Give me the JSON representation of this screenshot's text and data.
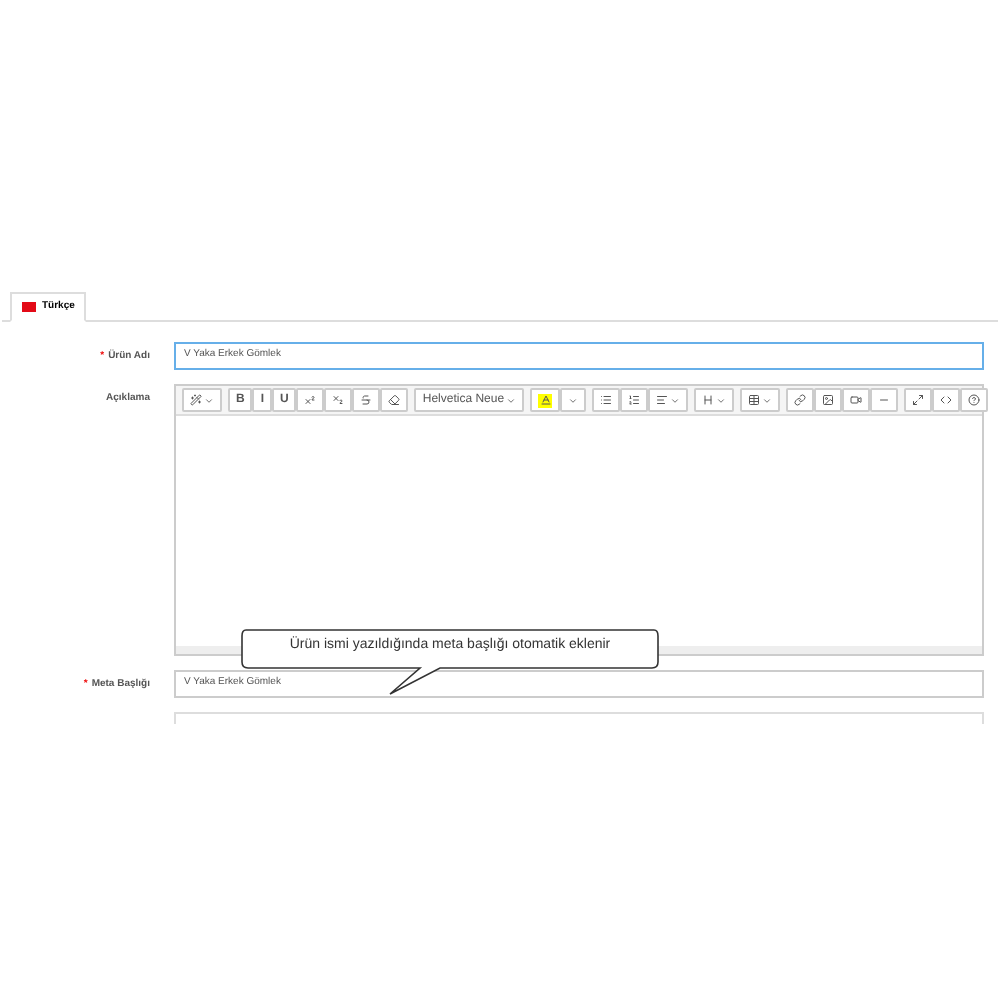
{
  "tabs": [
    {
      "label": "Türkçe",
      "selected": true
    }
  ],
  "fields": [
    {
      "kind": "input",
      "label": "Ürün Adı",
      "marker": "*",
      "value": "V Yaka Erkek Gömlek",
      "focused": true
    },
    {
      "kind": "editor",
      "label": "Açıklama",
      "font": "Helvetica Neue"
    },
    {
      "kind": "input",
      "label": "Meta Başlığı",
      "marker": "*",
      "value": "V Yaka Erkek Gömlek",
      "focused": false
    }
  ],
  "toolbar": [
    [
      {
        "kind": "style",
        "caret": true
      }
    ],
    [
      {
        "kind": "text",
        "label": "B"
      },
      {
        "kind": "text",
        "label": "I"
      },
      {
        "kind": "text",
        "label": "U"
      },
      {
        "kind": "sup"
      },
      {
        "kind": "sub"
      },
      {
        "kind": "strike"
      },
      {
        "kind": "eraser"
      }
    ],
    [
      {
        "kind": "font",
        "caret": true
      }
    ],
    [
      {
        "kind": "color"
      },
      {
        "kind": "caret"
      }
    ],
    [
      {
        "kind": "ul"
      },
      {
        "kind": "ol"
      },
      {
        "kind": "align",
        "caret": true
      }
    ],
    [
      {
        "kind": "height",
        "caret": true
      }
    ],
    [
      {
        "kind": "table",
        "caret": true
      }
    ],
    [
      {
        "kind": "link"
      },
      {
        "kind": "image"
      },
      {
        "kind": "video"
      },
      {
        "kind": "hr"
      }
    ],
    [
      {
        "kind": "fullscreen"
      },
      {
        "kind": "code"
      },
      {
        "kind": "help"
      }
    ]
  ],
  "callout": "Ürün ismi yazıldığında meta başlığı otomatik eklenir"
}
